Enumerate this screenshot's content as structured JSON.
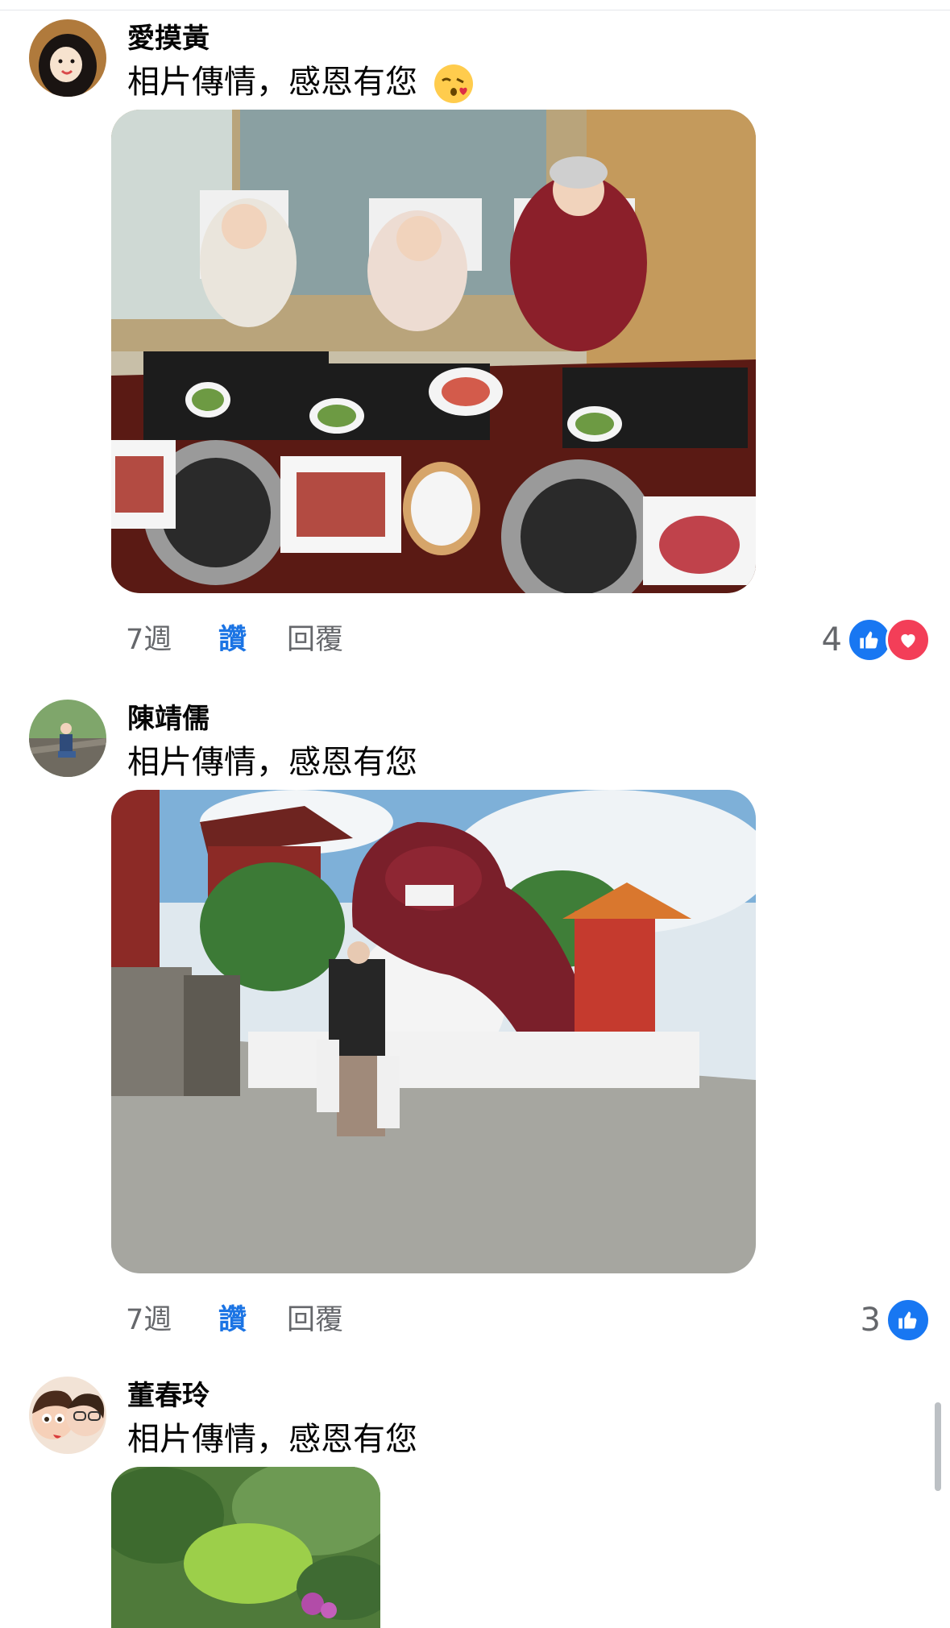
{
  "comments": [
    {
      "author": "愛摸黃",
      "text": "相片傳情，感恩有您",
      "emoji": "kiss-face-emoji",
      "photo": "restaurant-bbq-photo",
      "time": "7週",
      "like_label": "讚",
      "reply_label": "回覆",
      "reaction_count": "4",
      "reactions": [
        "like",
        "love"
      ]
    },
    {
      "author": "陳靖儒",
      "text": "相片傳情，感恩有您",
      "photo": "temple-lion-photo",
      "time": "7週",
      "like_label": "讚",
      "reply_label": "回覆",
      "reaction_count": "3",
      "reactions": [
        "like"
      ]
    },
    {
      "author": "董春玲",
      "text": "相片傳情，感恩有您",
      "photo": "garden-photo"
    }
  ],
  "colors": {
    "like_blue": "#1877f2",
    "love_red": "#f33e58",
    "action_link": "#1b74e4",
    "meta_gray": "#65676b"
  }
}
